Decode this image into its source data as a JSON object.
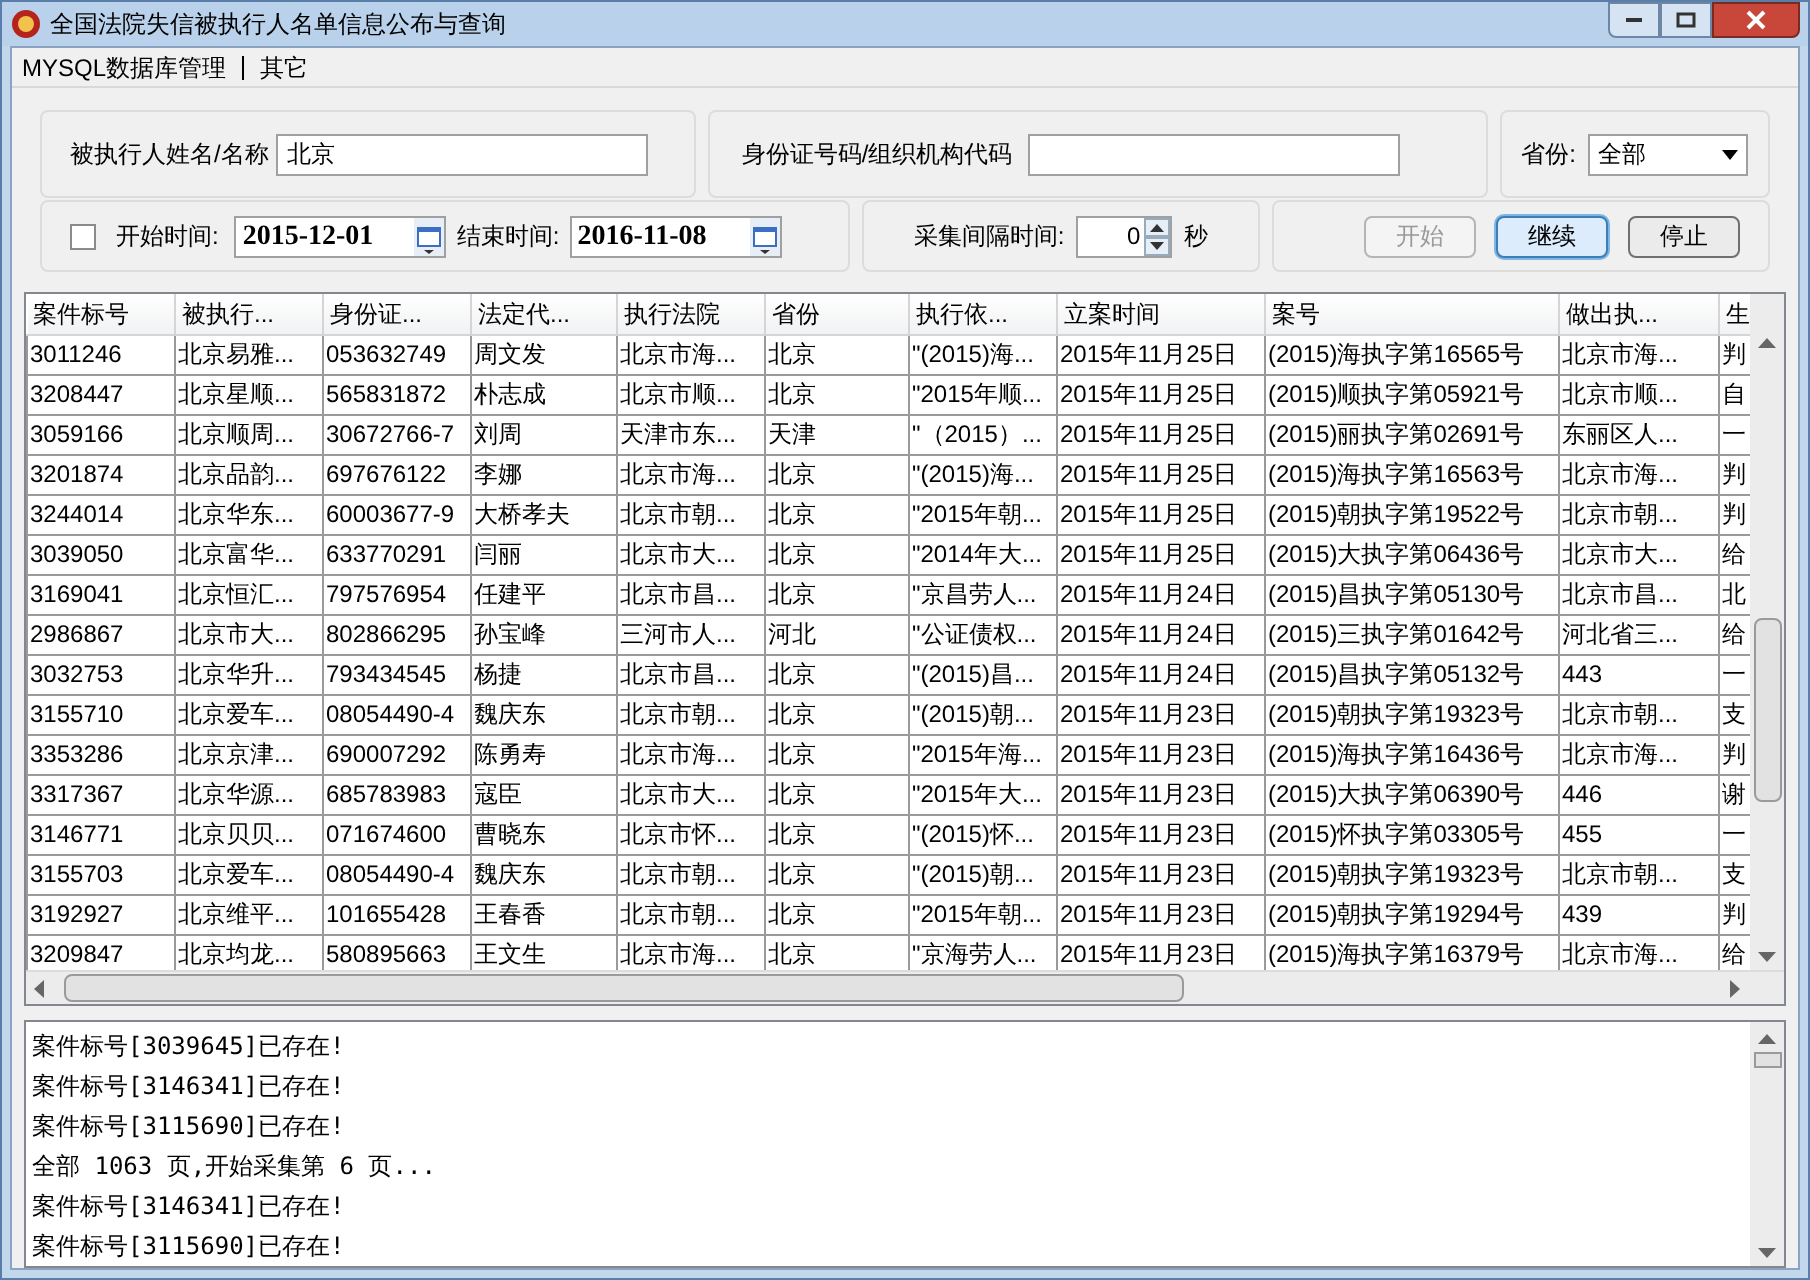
{
  "window": {
    "title": "全国法院失信被执行人名单信息公布与查询"
  },
  "menu": [
    {
      "label": "MYSQL数据库管理"
    },
    {
      "label": "其它"
    }
  ],
  "search": {
    "name_label": "被执行人姓名/名称",
    "name_value": "北京",
    "id_label": "身份证号码/组织机构代码",
    "province_label": "省份:",
    "province_value": "全部"
  },
  "time": {
    "start_checked": false,
    "start_label": "开始时间:",
    "start_value": "2015-12-01",
    "end_label": "结束时间:",
    "end_value": "2016-11-08"
  },
  "interval": {
    "label": "采集间隔时间:",
    "value": "0",
    "unit": "秒"
  },
  "buttons": [
    {
      "label": "开始",
      "disabled": true,
      "focused": false
    },
    {
      "label": "继续",
      "disabled": false,
      "focused": true
    },
    {
      "label": "停止",
      "disabled": false,
      "focused": false
    }
  ],
  "table": {
    "columns": [
      "案件标号",
      "被执行...",
      "身份证...",
      "法定代...",
      "执行法院",
      "省份",
      "执行依...",
      "立案时间",
      "案号",
      "做出执...",
      "生"
    ],
    "rows": [
      [
        "3011246",
        "北京易雅...",
        "053632749",
        "周文发",
        "北京市海...",
        "北京",
        "\"(2015)海...",
        "2015年11月25日",
        "(2015)海执字第16565号",
        "北京市海...",
        "判"
      ],
      [
        "3208447",
        "北京星顺...",
        "565831872",
        "朴志成",
        "北京市顺...",
        "北京",
        "\"2015年顺...",
        "2015年11月25日",
        "(2015)顺执字第05921号",
        "北京市顺...",
        "自"
      ],
      [
        "3059166",
        "北京顺周...",
        "30672766-7",
        "刘周",
        "天津市东...",
        "天津",
        "\"（2015）...",
        "2015年11月25日",
        "(2015)丽执字第02691号",
        "东丽区人...",
        "一"
      ],
      [
        "3201874",
        "北京品韵...",
        "697676122",
        "李娜",
        "北京市海...",
        "北京",
        "\"(2015)海...",
        "2015年11月25日",
        "(2015)海执字第16563号",
        "北京市海...",
        "判"
      ],
      [
        "3244014",
        "北京华东...",
        "60003677-9",
        "大桥孝夫",
        "北京市朝...",
        "北京",
        "\"2015年朝...",
        "2015年11月25日",
        "(2015)朝执字第19522号",
        "北京市朝...",
        "判"
      ],
      [
        "3039050",
        "北京富华...",
        "633770291",
        "闫丽",
        "北京市大...",
        "北京",
        "\"2014年大...",
        "2015年11月25日",
        "(2015)大执字第06436号",
        "北京市大...",
        "给"
      ],
      [
        "3169041",
        "北京恒汇...",
        "797576954",
        "任建平",
        "北京市昌...",
        "北京",
        "\"京昌劳人...",
        "2015年11月24日",
        "(2015)昌执字第05130号",
        "北京市昌...",
        "北"
      ],
      [
        "2986867",
        "北京市大...",
        "802866295",
        "孙宝峰",
        "三河市人...",
        "河北",
        "\"公证债权...",
        "2015年11月24日",
        "(2015)三执字第01642号",
        "河北省三...",
        "给"
      ],
      [
        "3032753",
        "北京华升...",
        "793434545",
        "杨捷",
        "北京市昌...",
        "北京",
        "\"(2015)昌...",
        "2015年11月24日",
        "(2015)昌执字第05132号",
        "443",
        "一"
      ],
      [
        "3155710",
        "北京爱车...",
        "08054490-4",
        "魏庆东",
        "北京市朝...",
        "北京",
        "\"(2015)朝...",
        "2015年11月23日",
        "(2015)朝执字第19323号",
        "北京市朝...",
        "支"
      ],
      [
        "3353286",
        "北京京津...",
        "690007292",
        "陈勇寿",
        "北京市海...",
        "北京",
        "\"2015年海...",
        "2015年11月23日",
        "(2015)海执字第16436号",
        "北京市海...",
        "判"
      ],
      [
        "3317367",
        "北京华源...",
        "685783983",
        "寇臣",
        "北京市大...",
        "北京",
        "\"2015年大...",
        "2015年11月23日",
        "(2015)大执字第06390号",
        "446",
        "谢"
      ],
      [
        "3146771",
        "北京贝贝...",
        "071674600",
        "曹晓东",
        "北京市怀...",
        "北京",
        "\"(2015)怀...",
        "2015年11月23日",
        "(2015)怀执字第03305号",
        "455",
        "一"
      ],
      [
        "3155703",
        "北京爱车...",
        "08054490-4",
        "魏庆东",
        "北京市朝...",
        "北京",
        "\"(2015)朝...",
        "2015年11月23日",
        "(2015)朝执字第19323号",
        "北京市朝...",
        "支"
      ],
      [
        "3192927",
        "北京维平...",
        "101655428",
        "王春香",
        "北京市朝...",
        "北京",
        "\"2015年朝...",
        "2015年11月23日",
        "(2015)朝执字第19294号",
        "439",
        "判"
      ],
      [
        "3209847",
        "北京均龙...",
        "580895663",
        "王文生",
        "北京市海...",
        "北京",
        "\"京海劳人...",
        "2015年11月23日",
        "(2015)海执字第16379号",
        "北京市海...",
        "给"
      ]
    ]
  },
  "log": [
    "案件标号[3039645]已存在!",
    "案件标号[3146341]已存在!",
    "案件标号[3115690]已存在!",
    "全部 1063 页,开始采集第 6 页...",
    "案件标号[3146341]已存在!",
    "案件标号[3115690]已存在!"
  ]
}
